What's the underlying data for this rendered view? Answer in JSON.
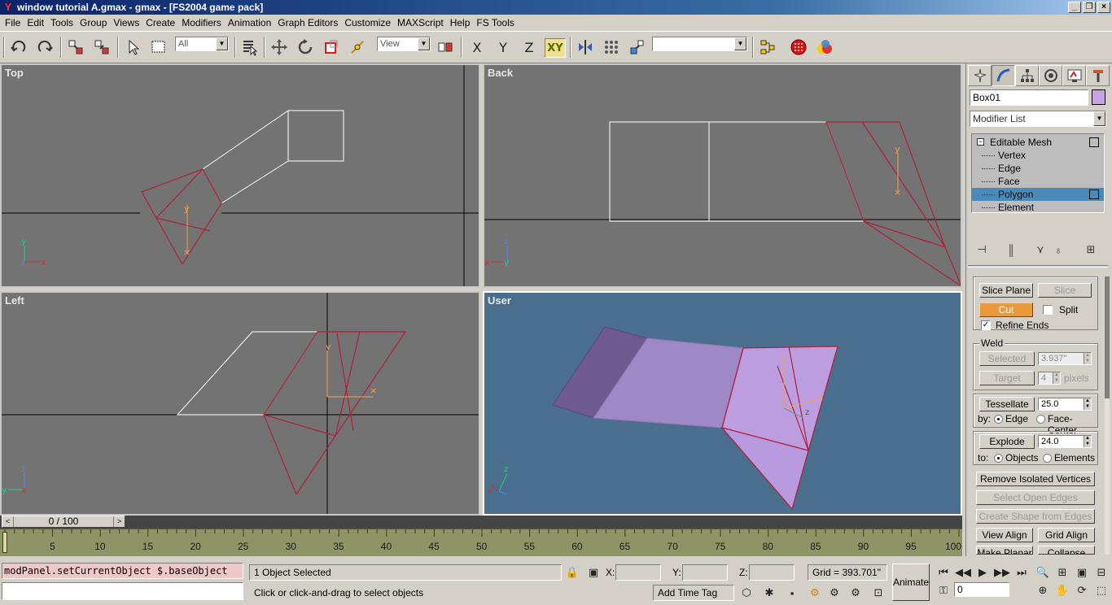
{
  "window": {
    "title": "window tutorial A.gmax - gmax - [FS2004 game pack]",
    "controls": [
      "_",
      "❐",
      "×"
    ]
  },
  "menu": [
    "File",
    "Edit",
    "Tools",
    "Group",
    "Views",
    "Create",
    "Modifiers",
    "Animation",
    "Graph Editors",
    "Customize",
    "MAXScript",
    "Help",
    "FS Tools"
  ],
  "toolbar": {
    "selection_filter": "All",
    "ref_coord": "View",
    "named_selection": "",
    "axes": {
      "x": "X",
      "y": "Y",
      "z": "Z",
      "xy": "XY"
    }
  },
  "viewports": {
    "top": "Top",
    "back": "Back",
    "left": "Left",
    "user": "User"
  },
  "colors": {
    "viewport_bg": "#737373",
    "user_bg": "#4a6f8e",
    "wire_selected": "#b0203c",
    "wire_white": "#ffffff",
    "object_color": "#c8a0e6",
    "stack_selected": "#4a8ab8",
    "cut_orange": "#e89a3a",
    "trackbar": "#8f9466"
  },
  "command_panel": {
    "object_name": "Box01",
    "modifier_list": "Modifier List",
    "stack": {
      "root": "Editable Mesh",
      "children": [
        "Vertex",
        "Edge",
        "Face",
        "Polygon",
        "Element"
      ],
      "selected": "Polygon"
    },
    "rollout": {
      "slice_plane": "Slice Plane",
      "slice": "Slice",
      "cut": "Cut",
      "split": "Split",
      "refine_ends": "Refine Ends",
      "weld_group": "Weld",
      "selected_btn": "Selected",
      "selected_val": "3.937\"",
      "target_btn": "Target",
      "target_val": "4",
      "pixels": "pixels",
      "tessellate": "Tessellate",
      "tessellate_val": "25.0",
      "by": "by:",
      "edge": "Edge",
      "face_center": "Face-Center",
      "explode": "Explode",
      "explode_val": "24.0",
      "to": "to:",
      "objects": "Objects",
      "elements": "Elements",
      "remove_isolated": "Remove Isolated Vertices",
      "select_open_edges": "Select Open Edges",
      "create_shape": "Create Shape from Edges",
      "view_align": "View Align",
      "grid_align": "Grid Align",
      "make_planar": "Make Planar",
      "collapse": "Collapse"
    }
  },
  "timeline": {
    "frame_display": "0 / 100",
    "ticks": [
      "5",
      "10",
      "15",
      "20",
      "25",
      "30",
      "35",
      "40",
      "45",
      "50",
      "55",
      "60",
      "65",
      "70",
      "75",
      "80",
      "85",
      "90",
      "95",
      "100"
    ]
  },
  "status": {
    "listener": "modPanel.setCurrentObject $.baseObject",
    "selected": "1 Object Selected",
    "prompt": "Click or click-and-drag to select objects",
    "x_label": "X:",
    "y_label": "Y:",
    "z_label": "Z:",
    "grid": "Grid = 393.701\"",
    "add_time_tag": "Add Time Tag",
    "animate": "Animate",
    "frame": "0"
  }
}
